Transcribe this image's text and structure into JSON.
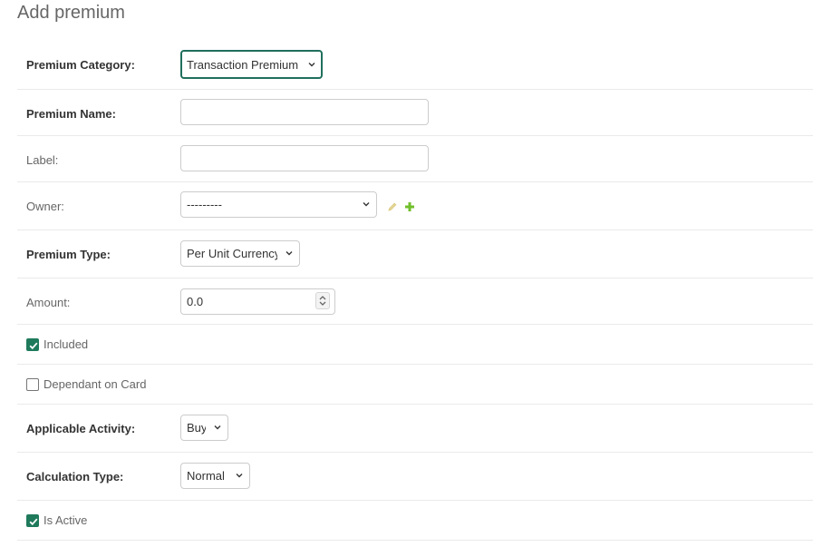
{
  "page": {
    "title": "Add premium"
  },
  "fields": {
    "premium_category": {
      "label": "Premium Category:",
      "value": "Transaction Premium"
    },
    "premium_name": {
      "label": "Premium Name:",
      "value": ""
    },
    "label": {
      "label": "Label:",
      "value": ""
    },
    "owner": {
      "label": "Owner:",
      "value": "---------"
    },
    "premium_type": {
      "label": "Premium Type:",
      "value": "Per Unit Currency"
    },
    "amount": {
      "label": "Amount:",
      "value": "0.0"
    },
    "included": {
      "label": "Included",
      "checked": true
    },
    "dependant_on_card": {
      "label": "Dependant on Card",
      "checked": false
    },
    "applicable_activity": {
      "label": "Applicable Activity:",
      "value": "Buy"
    },
    "calculation_type": {
      "label": "Calculation Type:",
      "value": "Normal"
    },
    "is_active": {
      "label": "Is Active",
      "checked": true
    }
  },
  "colors": {
    "accent": "#1f7a5c",
    "focus_border": "#1f6f5c",
    "add_icon": "#70bf2b",
    "change_icon": "#e6d89a"
  },
  "icons": {
    "owner_change": "pencil-icon",
    "owner_add": "plus-icon",
    "select_arrow": "chevron-down-icon",
    "checkbox_check": "checkmark-icon"
  }
}
